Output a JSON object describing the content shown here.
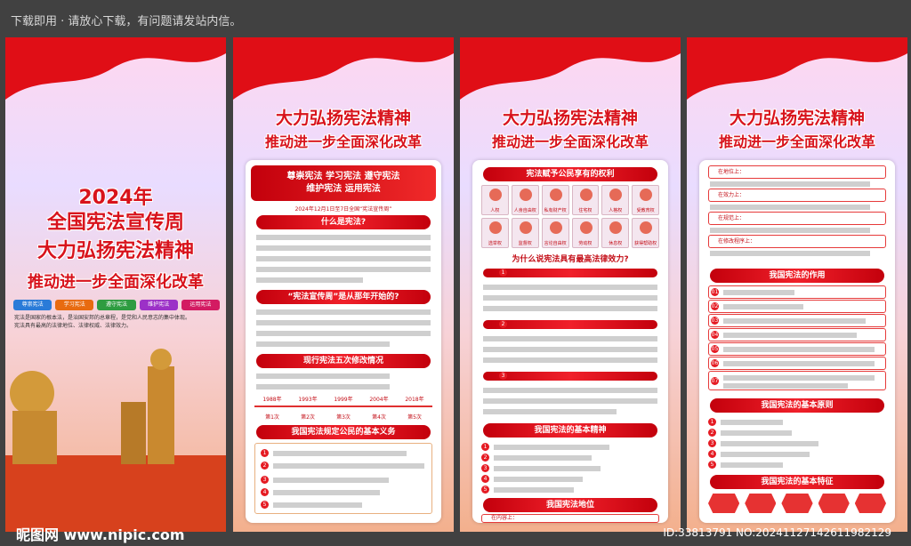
{
  "top_notice": "下载即用 · 请放心下载，有问题请发站内信。",
  "panel1": {
    "year": "2024年",
    "line1": "全国宪法宣传周",
    "line2": "大力弘扬宪法精神",
    "line3": "推动进一步全面深化改革",
    "tags": [
      "尊崇宪法",
      "学习宪法",
      "遵守宪法",
      "维护宪法",
      "运用宪法"
    ],
    "desc1": "宪法是国家的根本法，是治国安邦的总章程，是党和人民意志的集中体现。",
    "desc2": "宪法具有最高的法律地位、法律权威、法律效力。"
  },
  "shared_title": {
    "line1": "大力弘扬宪法精神",
    "line2": "推动进一步全面深化改革"
  },
  "panel2": {
    "banner1": "尊崇宪法 学习宪法 遵守宪法",
    "banner2": "维护宪法 运用宪法",
    "date_line": "2024年12月1日至7日全国“宪法宣传周”",
    "h1": "什么是宪法?",
    "h2": "“宪法宣传周”是从那年开始的?",
    "h3": "现行宪法五次修改情况",
    "years": [
      "1988年",
      "1993年",
      "1999年",
      "2004年",
      "2018年"
    ],
    "times": [
      "第1次",
      "第2次",
      "第3次",
      "第4次",
      "第5次"
    ],
    "h4": "我国宪法规定公民的基本义务"
  },
  "panel3": {
    "h1": "宪法赋予公民享有的权利",
    "rights": [
      "人权",
      "人身自由权",
      "私有财产权",
      "住宅权",
      "人格权",
      "受教育权",
      "选举权",
      "监督权",
      "言论自由权",
      "劳动权",
      "休息权",
      "获得帮助权"
    ],
    "h2": "为什么说宪法具有最高法律效力?",
    "h3": "我国宪法的基本精神",
    "h4": "我国宪法地位",
    "l1": "在内容上："
  },
  "panel4": {
    "items": [
      "在地位上：",
      "在效力上：",
      "在规范上：",
      "在修改程序上："
    ],
    "h1": "我国宪法的作用",
    "nums": [
      "01",
      "02",
      "03",
      "04",
      "05",
      "06",
      "07"
    ],
    "h2": "我国宪法的基本原则",
    "h3": "我国宪法的基本特征"
  },
  "watermark": {
    "logo": "昵图网 www.nipic.com",
    "id": "ID:33813791 NO:20241127142611982129"
  }
}
